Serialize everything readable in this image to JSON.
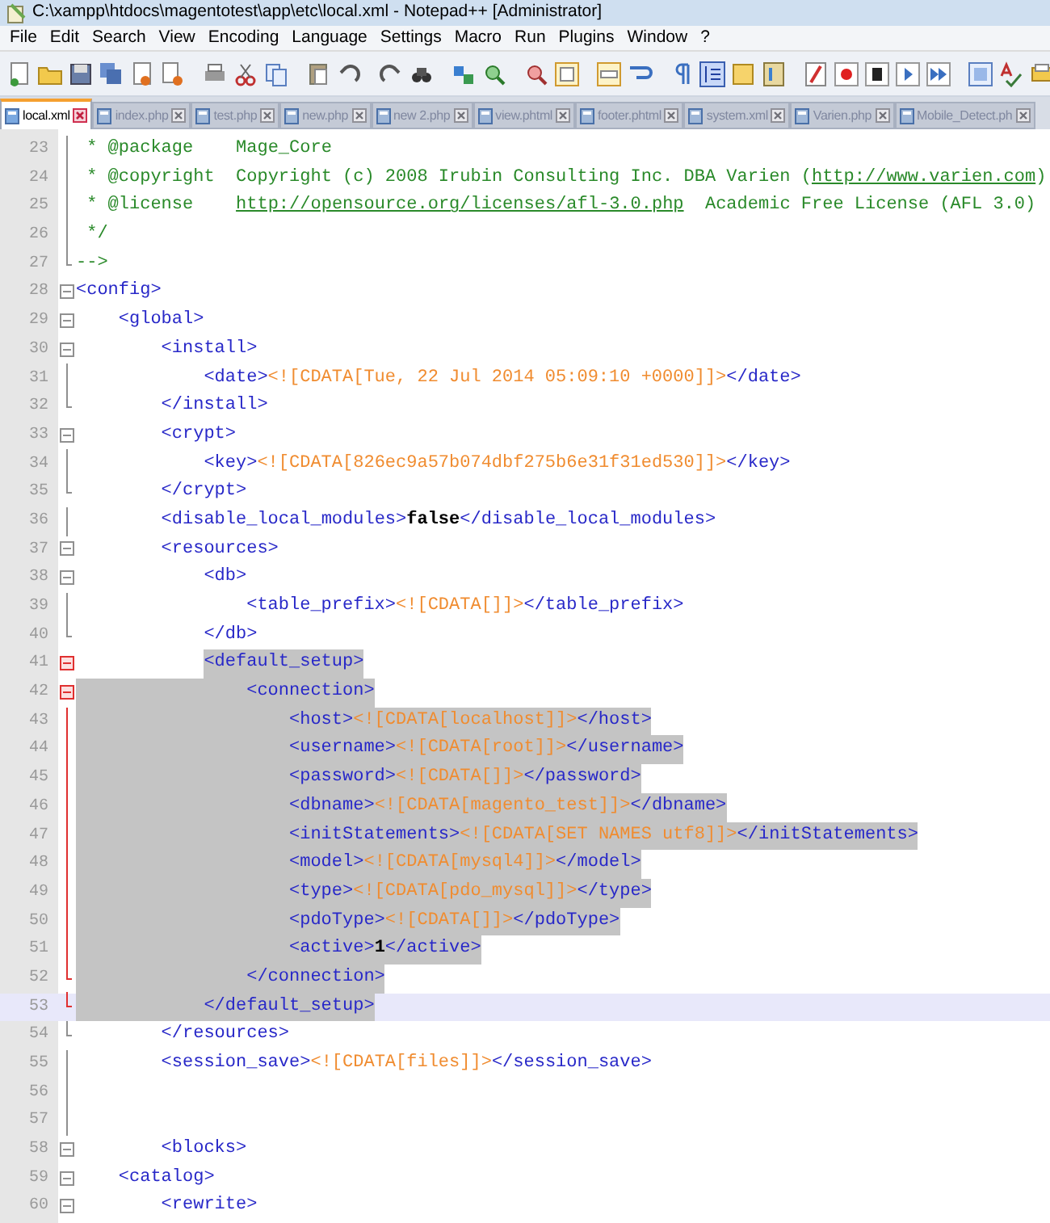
{
  "window": {
    "title": "C:\\xampp\\htdocs\\magentotest\\app\\etc\\local.xml - Notepad++ [Administrator]"
  },
  "menu": [
    "File",
    "Edit",
    "Search",
    "View",
    "Encoding",
    "Language",
    "Settings",
    "Macro",
    "Run",
    "Plugins",
    "Window",
    "?"
  ],
  "tabs": [
    {
      "label": "local.xml",
      "selected": true
    },
    {
      "label": "index.php",
      "selected": false
    },
    {
      "label": "test.php",
      "selected": false
    },
    {
      "label": "new.php",
      "selected": false
    },
    {
      "label": "new 2.php",
      "selected": false
    },
    {
      "label": "view.phtml",
      "selected": false
    },
    {
      "label": "footer.phtml",
      "selected": false
    },
    {
      "label": "system.xml",
      "selected": false
    },
    {
      "label": "Varien.php",
      "selected": false
    },
    {
      "label": "Mobile_Detect.ph",
      "selected": false
    }
  ],
  "lines": [
    {
      "number": "23",
      "kind": "line",
      "selected": false,
      "current": false,
      "segments": [
        {
          "kind": "comment",
          "text": " * @package    Mage_Core"
        }
      ]
    },
    {
      "number": "24",
      "kind": "line",
      "selected": false,
      "current": false,
      "segments": [
        {
          "kind": "comment",
          "text": " * @copyright  Copyright (c) 2008 Irubin Consulting Inc. DBA Varien ("
        },
        {
          "kind": "link",
          "text": "http://www.varien.com"
        },
        {
          "kind": "comment",
          "text": ")"
        }
      ]
    },
    {
      "number": "25",
      "kind": "line",
      "selected": false,
      "current": false,
      "segments": [
        {
          "kind": "comment",
          "text": " * @license    "
        },
        {
          "kind": "link",
          "text": "http://opensource.org/licenses/afl-3.0.php"
        },
        {
          "kind": "comment",
          "text": "  Academic Free License (AFL 3.0)"
        }
      ]
    },
    {
      "number": "26",
      "kind": "line",
      "selected": false,
      "current": false,
      "segments": [
        {
          "kind": "comment",
          "text": " */"
        }
      ]
    },
    {
      "number": "27",
      "kind": "end",
      "selected": false,
      "current": false,
      "segments": [
        {
          "kind": "comment",
          "text": "-->"
        }
      ]
    },
    {
      "number": "28",
      "kind": "open",
      "selected": false,
      "current": false,
      "segments": [
        {
          "kind": "tag",
          "text": "<config>"
        }
      ],
      "children": [
        {
          "number": "29",
          "kind": "open",
          "selected": false,
          "current": false,
          "segments": [
            {
              "kind": "tag",
              "text": "<global>"
            }
          ],
          "children": [
            {
              "number": "30",
              "kind": "open",
              "selected": false,
              "current": false,
              "segments": [
                {
                  "kind": "tag",
                  "text": "<install>"
                }
              ],
              "children": [
                {
                  "number": "31",
                  "kind": "line",
                  "selected": false,
                  "current": false,
                  "segments": [
                    {
                      "kind": "tag",
                      "text": "<date>"
                    },
                    {
                      "kind": "cdata",
                      "text": "<![CDATA[Tue, 22 Jul 2014 05:09:10 +0000]]>"
                    },
                    {
                      "kind": "tag",
                      "text": "</date>"
                    }
                  ]
                }
              ]
            },
            {
              "number": "32",
              "kind": "end",
              "selected": false,
              "current": false,
              "segments": [
                {
                  "kind": "tag",
                  "text": "</install>"
                }
              ]
            },
            {
              "number": "33",
              "kind": "open",
              "selected": false,
              "current": false,
              "segments": [
                {
                  "kind": "tag",
                  "text": "<crypt>"
                }
              ],
              "children": [
                {
                  "number": "34",
                  "kind": "line",
                  "selected": false,
                  "current": false,
                  "segments": [
                    {
                      "kind": "tag",
                      "text": "<key>"
                    },
                    {
                      "kind": "cdata",
                      "text": "<![CDATA[826ec9a57b074dbf275b6e31f31ed530]]>"
                    },
                    {
                      "kind": "tag",
                      "text": "</key>"
                    }
                  ]
                }
              ]
            },
            {
              "number": "35",
              "kind": "end",
              "selected": false,
              "current": false,
              "segments": [
                {
                  "kind": "tag",
                  "text": "</crypt>"
                }
              ]
            },
            {
              "number": "36",
              "kind": "line",
              "selected": false,
              "current": false,
              "segments": [
                {
                  "kind": "tag",
                  "text": "<disable_local_modules>"
                },
                {
                  "kind": "value",
                  "text": "false"
                },
                {
                  "kind": "tag",
                  "text": "</disable_local_modules>"
                }
              ]
            },
            {
              "number": "37",
              "kind": "open",
              "selected": false,
              "current": false,
              "segments": [
                {
                  "kind": "tag",
                  "text": "<resources>"
                }
              ],
              "children": [
                {
                  "number": "38",
                  "kind": "open",
                  "selected": false,
                  "current": false,
                  "segments": [
                    {
                      "kind": "tag",
                      "text": "<db>"
                    }
                  ],
                  "children": [
                    {
                      "number": "39",
                      "kind": "line",
                      "selected": false,
                      "current": false,
                      "segments": [
                        {
                          "kind": "tag",
                          "text": "<table_prefix>"
                        },
                        {
                          "kind": "cdata",
                          "text": "<![CDATA[]]>"
                        },
                        {
                          "kind": "tag",
                          "text": "</table_prefix>"
                        }
                      ]
                    }
                  ]
                },
                {
                  "number": "40",
                  "kind": "end",
                  "selected": false,
                  "current": false,
                  "segments": [
                    {
                      "kind": "tag",
                      "text": "</db>"
                    }
                  ]
                },
                {
                  "number": "41",
                  "kind": "open",
                  "selected": true,
                  "current": false,
                  "segments": [
                    {
                      "kind": "tag",
                      "text": "<default_setup>"
                    }
                  ],
                  "children": [
                    {
                      "number": "42",
                      "kind": "open",
                      "selected": true,
                      "current": false,
                      "segments": [
                        {
                          "kind": "tag",
                          "text": "<connection>"
                        }
                      ],
                      "children": [
                        {
                          "number": "43",
                          "kind": "line",
                          "selected": true,
                          "current": false,
                          "segments": [
                            {
                              "kind": "tag",
                              "text": "<host>"
                            },
                            {
                              "kind": "cdata",
                              "text": "<![CDATA[localhost]]>"
                            },
                            {
                              "kind": "tag",
                              "text": "</host>"
                            }
                          ]
                        },
                        {
                          "number": "44",
                          "kind": "line",
                          "selected": true,
                          "current": false,
                          "segments": [
                            {
                              "kind": "tag",
                              "text": "<username>"
                            },
                            {
                              "kind": "cdata",
                              "text": "<![CDATA[root]]>"
                            },
                            {
                              "kind": "tag",
                              "text": "</username>"
                            }
                          ]
                        },
                        {
                          "number": "45",
                          "kind": "line",
                          "selected": true,
                          "current": false,
                          "segments": [
                            {
                              "kind": "tag",
                              "text": "<password>"
                            },
                            {
                              "kind": "cdata",
                              "text": "<![CDATA[]]>"
                            },
                            {
                              "kind": "tag",
                              "text": "</password>"
                            }
                          ]
                        },
                        {
                          "number": "46",
                          "kind": "line",
                          "selected": true,
                          "current": false,
                          "segments": [
                            {
                              "kind": "tag",
                              "text": "<dbname>"
                            },
                            {
                              "kind": "cdata",
                              "text": "<![CDATA[magento_test]]>"
                            },
                            {
                              "kind": "tag",
                              "text": "</dbname>"
                            }
                          ]
                        },
                        {
                          "number": "47",
                          "kind": "line",
                          "selected": true,
                          "current": false,
                          "segments": [
                            {
                              "kind": "tag",
                              "text": "<initStatements>"
                            },
                            {
                              "kind": "cdata",
                              "text": "<![CDATA[SET NAMES utf8]]>"
                            },
                            {
                              "kind": "tag",
                              "text": "</initStatements>"
                            }
                          ]
                        },
                        {
                          "number": "48",
                          "kind": "line",
                          "selected": true,
                          "current": false,
                          "segments": [
                            {
                              "kind": "tag",
                              "text": "<model>"
                            },
                            {
                              "kind": "cdata",
                              "text": "<![CDATA[mysql4]]>"
                            },
                            {
                              "kind": "tag",
                              "text": "</model>"
                            }
                          ]
                        },
                        {
                          "number": "49",
                          "kind": "line",
                          "selected": true,
                          "current": false,
                          "segments": [
                            {
                              "kind": "tag",
                              "text": "<type>"
                            },
                            {
                              "kind": "cdata",
                              "text": "<![CDATA[pdo_mysql]]>"
                            },
                            {
                              "kind": "tag",
                              "text": "</type>"
                            }
                          ]
                        },
                        {
                          "number": "50",
                          "kind": "line",
                          "selected": true,
                          "current": false,
                          "segments": [
                            {
                              "kind": "tag",
                              "text": "<pdoType>"
                            },
                            {
                              "kind": "cdata",
                              "text": "<![CDATA[]]>"
                            },
                            {
                              "kind": "tag",
                              "text": "</pdoType>"
                            }
                          ]
                        },
                        {
                          "number": "51",
                          "kind": "line",
                          "selected": true,
                          "current": false,
                          "segments": [
                            {
                              "kind": "tag",
                              "text": "<active>"
                            },
                            {
                              "kind": "value",
                              "text": "1"
                            },
                            {
                              "kind": "tag",
                              "text": "</active>"
                            }
                          ]
                        }
                      ]
                    },
                    {
                      "number": "52",
                      "kind": "end",
                      "selected": true,
                      "current": false,
                      "segments": [
                        {
                          "kind": "tag",
                          "text": "</connection>"
                        }
                      ]
                    }
                  ]
                },
                {
                  "number": "53",
                  "kind": "end",
                  "selected": true,
                  "current": true,
                  "segments": [
                    {
                      "kind": "tag",
                      "text": "</default_setup>"
                    }
                  ]
                }
              ]
            },
            {
              "number": "54",
              "kind": "end",
              "selected": false,
              "current": false,
              "segments": [
                {
                  "kind": "tag",
                  "text": "</resources>"
                }
              ]
            },
            {
              "number": "55",
              "kind": "line",
              "selected": false,
              "current": false,
              "segments": [
                {
                  "kind": "tag",
                  "text": "<session_save>"
                },
                {
                  "kind": "cdata",
                  "text": "<![CDATA[files]]>"
                },
                {
                  "kind": "tag",
                  "text": "</session_save>"
                }
              ]
            },
            {
              "number": "56",
              "kind": "line"
            },
            {
              "number": "57",
              "kind": "line"
            },
            {
              "number": "58",
              "kind": "open",
              "selected": false,
              "current": false,
              "segments": [
                {
                  "kind": "tag",
                  "text": "<blocks>"
                }
              ]
            }
          ]
        },
        {
          "number": "59",
          "kind": "open",
          "selected": false,
          "current": false,
          "segments": [
            {
              "kind": "tag",
              "text": "<catalog>"
            }
          ],
          "children": [
            {
              "number": "60",
              "kind": "open",
              "selected": false,
              "current": false,
              "segments": [
                {
                  "kind": "tag",
                  "text": "<rewrite>"
                }
              ]
            }
          ]
        }
      ]
    }
  ]
}
